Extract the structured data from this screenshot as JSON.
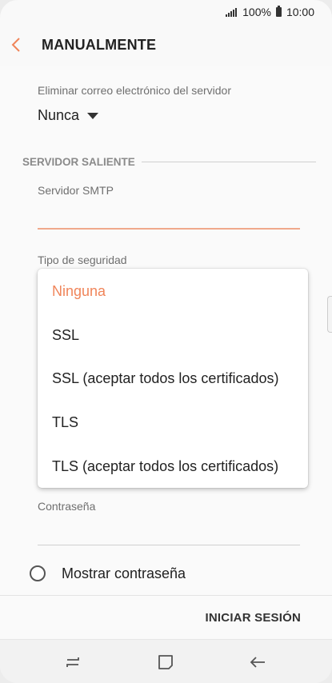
{
  "status_bar": {
    "battery": "100%",
    "time": "10:00"
  },
  "app_bar": {
    "title": "MANUALMENTE"
  },
  "form": {
    "delete_label": "Eliminar correo electrónico del servidor",
    "delete_value": "Nunca",
    "section_title": "SERVIDOR SALIENTE",
    "smtp_label": "Servidor SMTP",
    "smtp_value": "",
    "security_label": "Tipo de seguridad",
    "password_label": "Contraseña",
    "password_value": "",
    "show_password_label": "Mostrar contraseña"
  },
  "security_menu": {
    "options": [
      "Ninguna",
      "SSL",
      "SSL (aceptar todos los certificados)",
      "TLS",
      "TLS (aceptar todos los certificados)"
    ],
    "selected": "Ninguna"
  },
  "footer": {
    "signin_label": "INICIAR SESIÓN"
  },
  "colors": {
    "accent": "#f0855a",
    "text": "#222222",
    "secondary_text": "#6f6f6f"
  }
}
